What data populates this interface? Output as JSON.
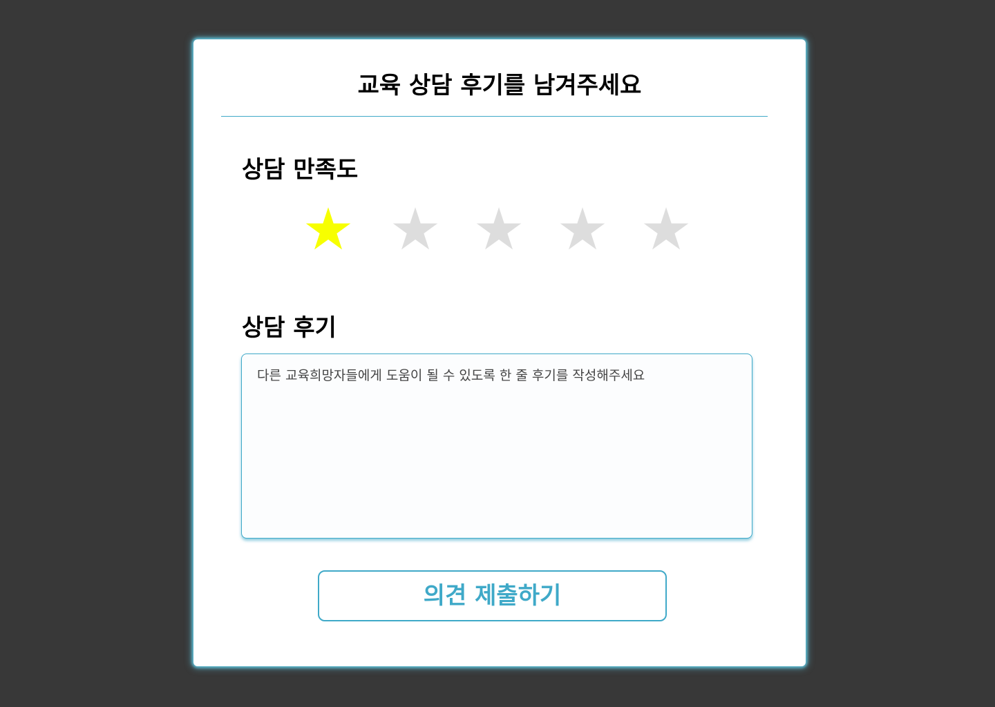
{
  "modal": {
    "title": "교육 상담 후기를 남겨주세요"
  },
  "rating": {
    "label": "상담 만족도",
    "value": 1,
    "max": 5,
    "star_glyph": "★",
    "filled_color": "#f7ff00",
    "empty_color": "#dddddd"
  },
  "review": {
    "label": "상담 후기",
    "value": "",
    "placeholder": "다른 교육희망자들에게 도움이 될 수 있도록 한 줄 후기를 작성해주세요"
  },
  "submit": {
    "label": "의견 제출하기"
  },
  "colors": {
    "accent": "#3fa9c8",
    "background": "#383838",
    "panel": "#ffffff"
  }
}
